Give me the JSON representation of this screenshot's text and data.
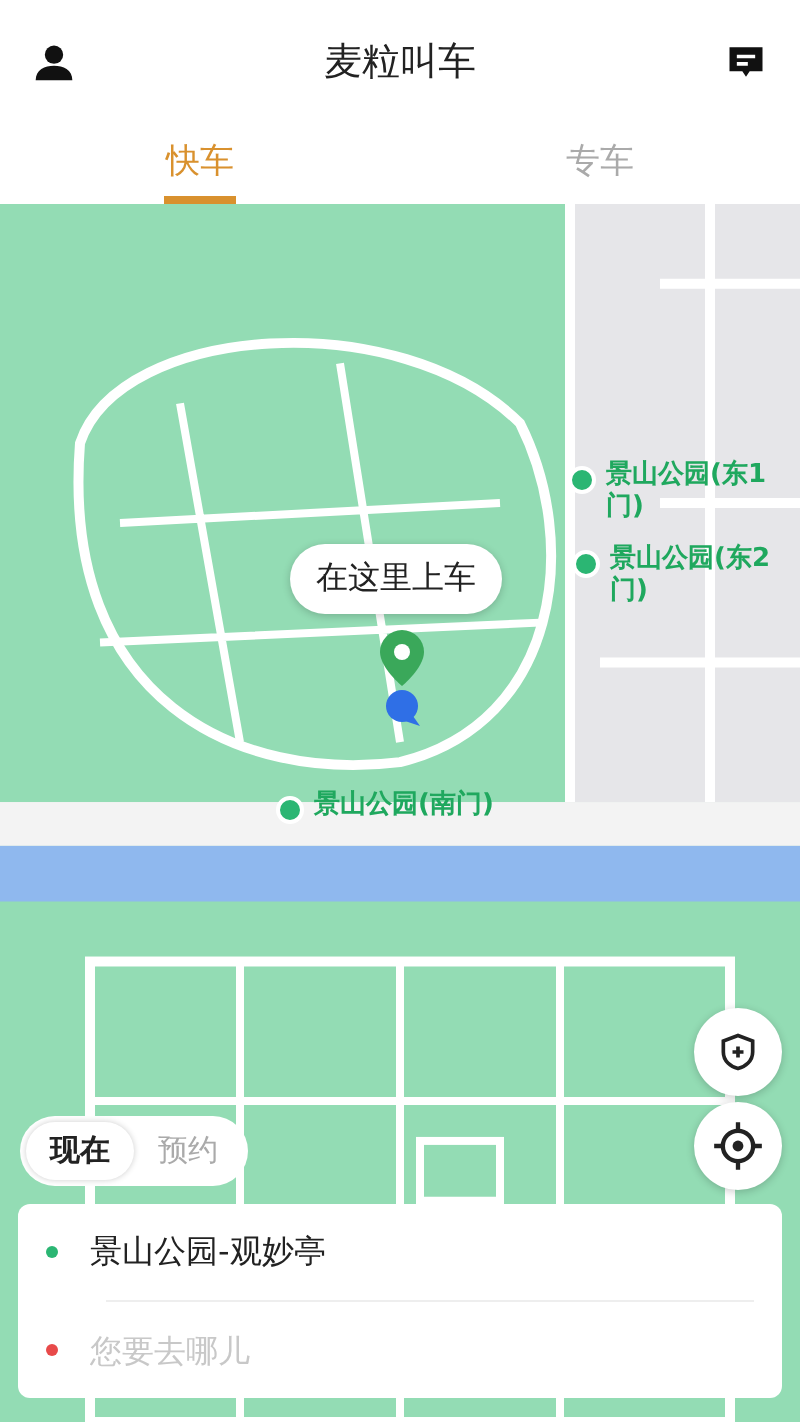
{
  "header": {
    "title": "麦粒叫车"
  },
  "tabs": [
    {
      "label": "快车",
      "selected": true
    },
    {
      "label": "专车",
      "selected": false
    }
  ],
  "map": {
    "kind": "picture",
    "callout": "在这里上车",
    "pickup_points": [
      {
        "label": "景山公园(东1门)"
      },
      {
        "label": "景山公园(东2门)"
      },
      {
        "label": "景山公园(南门)"
      }
    ]
  },
  "time_options": [
    {
      "label": "现在",
      "selected": true
    },
    {
      "label": "预约",
      "selected": false
    }
  ],
  "route": [
    {
      "kind": "value",
      "text": "景山公园-观妙亭",
      "color": "#2bb673"
    },
    {
      "kind": "placeholder",
      "placeholder": "您要去哪儿",
      "color": "#e84a4a"
    }
  ]
}
